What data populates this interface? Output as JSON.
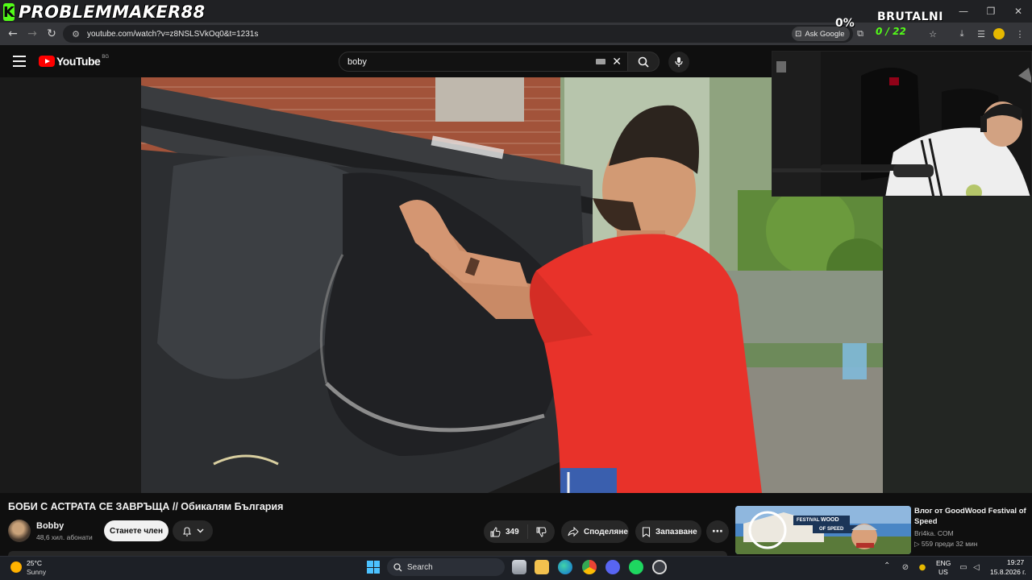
{
  "overlay": {
    "logo_letter": "K",
    "streamer_name": "PROBLEMMAKER88",
    "percent": "0%",
    "brand": "BRUTALNI",
    "counter": "0 / 22"
  },
  "browser": {
    "url": "youtube.com/watch?v=z8NSLSVkOq0&t=1231s",
    "ask_google_label": "Ask Google"
  },
  "youtube": {
    "logo_text": "YouTube",
    "region": "BG",
    "search_query": "boby"
  },
  "video": {
    "title": "БОБИ С АСТРАТА СЕ ЗАВРЪЩА // Обикалям България",
    "channel_name": "Bobby",
    "subscribers": "48,6 хил. абонати",
    "join_label": "Станете член",
    "like_count": "349",
    "share_label": "Споделяне",
    "save_label": "Запазване",
    "more_label": "⋯"
  },
  "recommendation": {
    "title": "Влог от GoodWood Festival of Speed",
    "channel": "Bri4ka. COM",
    "meta": "▷ 559  преди 32 мин",
    "thumb_text_left": "FESTIVAL",
    "thumb_text_right": "OF SPEED",
    "thumb_brand": "WOOD"
  },
  "taskbar": {
    "temperature": "25°C",
    "condition": "Sunny",
    "search_label": "Search",
    "lang_top": "ENG",
    "lang_bottom": "US",
    "time": "19:27",
    "date": "15.8.2026 г."
  },
  "colors": {
    "kick_green": "#53fc18",
    "yt_red": "#ff0000",
    "shirt_red": "#e8322a"
  }
}
